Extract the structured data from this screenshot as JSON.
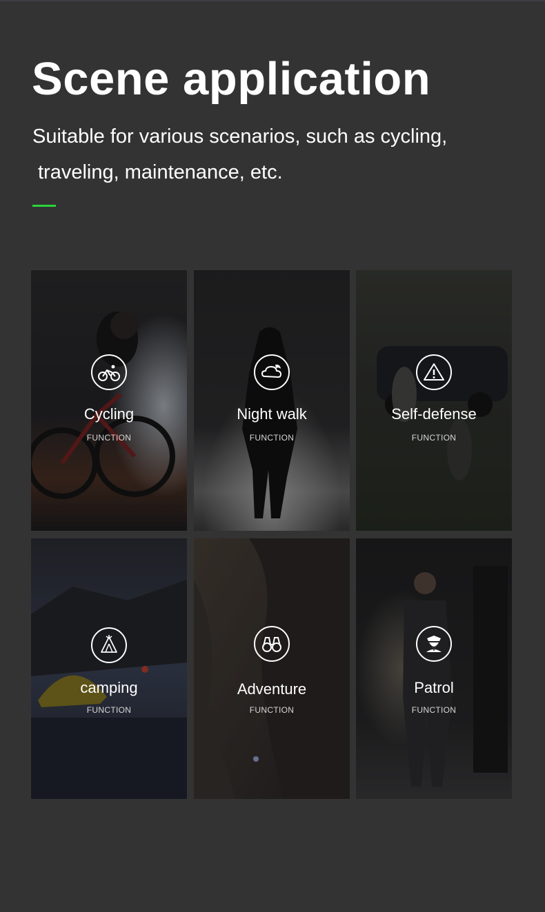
{
  "header": {
    "title": "Scene application",
    "subtitle_line1": "Suitable for various scenarios, such as cycling,",
    "subtitle_line2": "traveling, maintenance, etc.",
    "accent_color": "#2bd43a"
  },
  "cards": [
    {
      "label": "Cycling",
      "sub": "FUNCTION",
      "icon": "bicycle-icon"
    },
    {
      "label": "Night walk",
      "sub": "FUNCTION",
      "icon": "cloud-moon-icon"
    },
    {
      "label": "Self-defense",
      "sub": "FUNCTION",
      "icon": "warning-icon"
    },
    {
      "label": "camping",
      "sub": "FUNCTION",
      "icon": "tent-icon"
    },
    {
      "label": "Adventure",
      "sub": "FUNCTION",
      "icon": "binoculars-icon"
    },
    {
      "label": "Patrol",
      "sub": "FUNCTION",
      "icon": "security-guard-icon"
    }
  ]
}
